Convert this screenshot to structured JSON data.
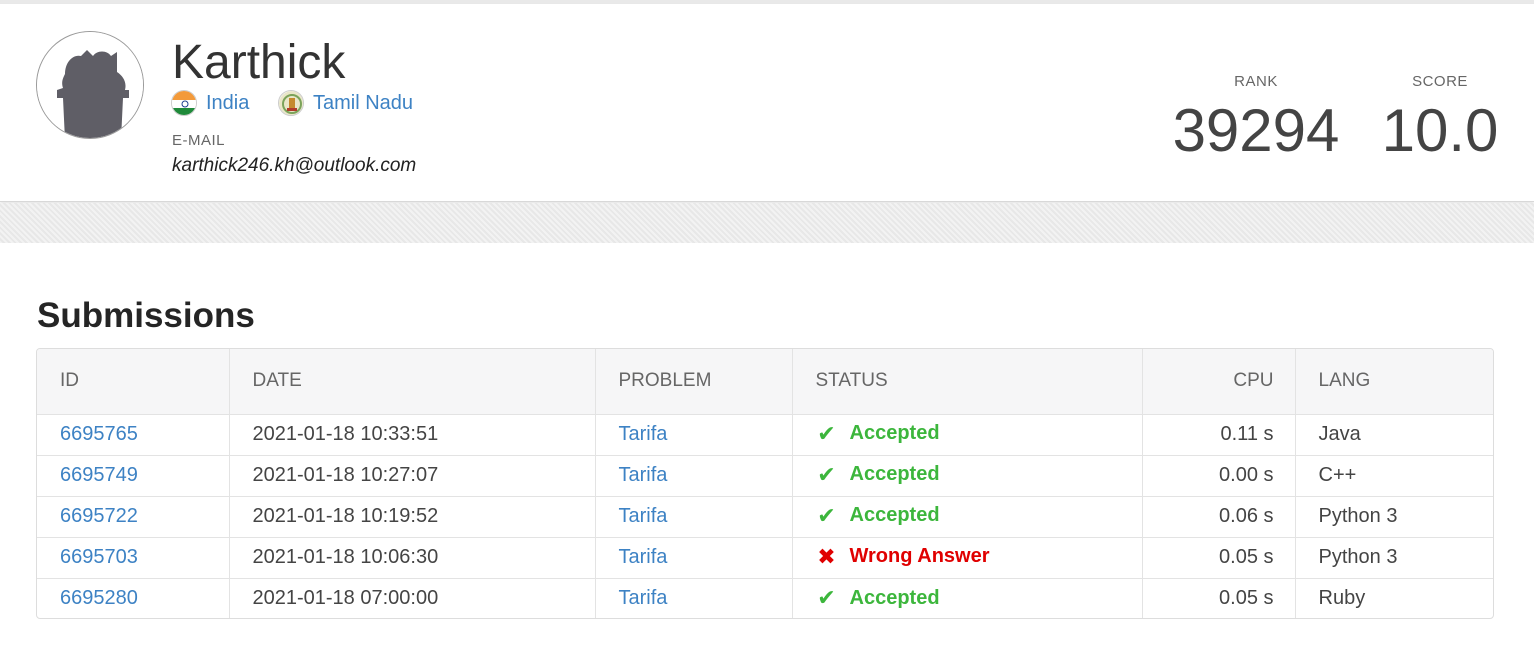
{
  "profile": {
    "name": "Karthick",
    "country": "India",
    "region": "Tamil Nadu",
    "email_label": "E-MAIL",
    "email": "karthick246.kh@outlook.com",
    "rank_label": "RANK",
    "rank": "39294",
    "score_label": "SCORE",
    "score": "10.0"
  },
  "submissions": {
    "title": "Submissions",
    "headers": {
      "id": "ID",
      "date": "DATE",
      "problem": "PROBLEM",
      "status": "STATUS",
      "cpu": "CPU",
      "lang": "LANG"
    },
    "rows": [
      {
        "id": "6695765",
        "date": "2021-01-18 10:33:51",
        "problem": "Tarifa",
        "status": "Accepted",
        "cpu": "0.11 s",
        "lang": "Java"
      },
      {
        "id": "6695749",
        "date": "2021-01-18 10:27:07",
        "problem": "Tarifa",
        "status": "Accepted",
        "cpu": "0.00 s",
        "lang": "C++"
      },
      {
        "id": "6695722",
        "date": "2021-01-18 10:19:52",
        "problem": "Tarifa",
        "status": "Accepted",
        "cpu": "0.06 s",
        "lang": "Python 3"
      },
      {
        "id": "6695703",
        "date": "2021-01-18 10:06:30",
        "problem": "Tarifa",
        "status": "Wrong Answer",
        "cpu": "0.05 s",
        "lang": "Python 3"
      },
      {
        "id": "6695280",
        "date": "2021-01-18 07:00:00",
        "problem": "Tarifa",
        "status": "Accepted",
        "cpu": "0.05 s",
        "lang": "Ruby"
      }
    ]
  },
  "colors": {
    "link": "#3d82c4",
    "accepted": "#3cb63c",
    "wrong": "#e00000"
  },
  "icons": {
    "accepted": "check-icon",
    "wrong": "cross-icon"
  }
}
